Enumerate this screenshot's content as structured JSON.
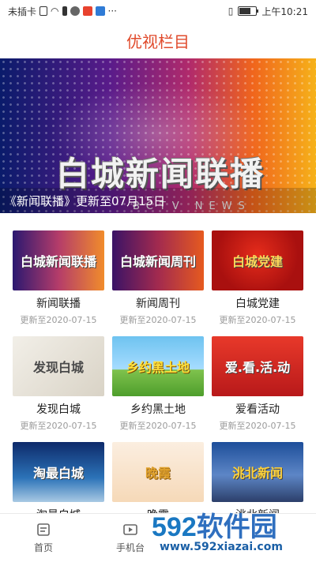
{
  "status_bar": {
    "left_text": "未插卡",
    "time": "上午10:21",
    "icons": [
      "sim-icon",
      "wifi-icon",
      "warning-icon",
      "wechat-icon",
      "app-icon",
      "browser-icon",
      "more-icon",
      "vibrate-icon",
      "battery-icon"
    ]
  },
  "header": {
    "title": "优视栏目"
  },
  "banner": {
    "logo_text": "白城新闻联播",
    "sub_text": "BCTV NEWS",
    "caption": "《新闻联播》更新至07月15日"
  },
  "cards": [
    {
      "title": "新闻联播",
      "date": "更新至2020-07-15",
      "thumb_text": "白城新闻联播"
    },
    {
      "title": "新闻周刊",
      "date": "更新至2020-07-15",
      "thumb_text": "白城新闻周刊"
    },
    {
      "title": "白城党建",
      "date": "更新至2020-07-15",
      "thumb_text": "白城党建"
    },
    {
      "title": "发现白城",
      "date": "更新至2020-07-15",
      "thumb_text": "发现白城"
    },
    {
      "title": "乡约黑土地",
      "date": "更新至2020-07-15",
      "thumb_text": "乡约黑土地"
    },
    {
      "title": "爱看活动",
      "date": "更新至2020-07-15",
      "thumb_text": "爱.看.活.动"
    },
    {
      "title": "淘最白城",
      "date": "",
      "thumb_text": "淘最白城"
    },
    {
      "title": "晚霞",
      "date": "",
      "thumb_text": "晚霞"
    },
    {
      "title": "洮北新闻",
      "date": "",
      "thumb_text": "洮北新闻"
    }
  ],
  "bottom_nav": {
    "items": [
      {
        "label": "首页",
        "icon": "home-icon"
      },
      {
        "label": "手机台",
        "icon": "tv-icon"
      }
    ]
  },
  "watermark": {
    "brand_num": "592",
    "brand_cn": "软件园",
    "url": "www.592xiazai.com"
  },
  "colors": {
    "accent": "#e04a2b"
  }
}
